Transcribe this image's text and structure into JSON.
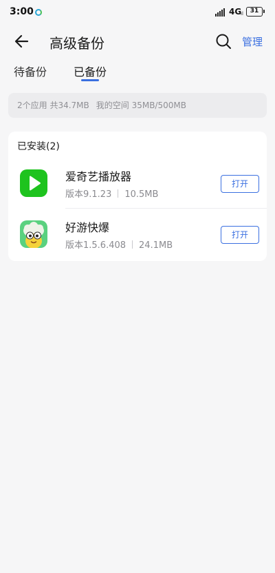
{
  "status_bar": {
    "time": "3:00",
    "network": "4G",
    "network_sub": "ıl",
    "battery": "31"
  },
  "header": {
    "title": "高级备份",
    "manage_label": "管理",
    "back_icon": "arrow-left-icon",
    "search_icon": "search-icon"
  },
  "tabs": [
    {
      "label": "待备份",
      "active": false
    },
    {
      "label": "已备份",
      "active": true
    }
  ],
  "storage": {
    "summary": "2个应用 共34.7MB",
    "space": "我的空间 35MB/500MB"
  },
  "installed": {
    "title": "已安装(2)",
    "apps": [
      {
        "name": "爱奇艺播放器",
        "version": "版本9.1.23",
        "size": "10.5MB",
        "button": "打开",
        "icon": "play-icon"
      },
      {
        "name": "好游快爆",
        "version": "版本1.5.6.408",
        "size": "24.1MB",
        "button": "打开",
        "icon": "haoyou-mascot-icon"
      }
    ]
  },
  "colors": {
    "accent": "#3a6fe0",
    "background": "#f6f6f7",
    "iqiyi_green": "#1ec31e",
    "haoyou_green": "#5ad17f"
  }
}
